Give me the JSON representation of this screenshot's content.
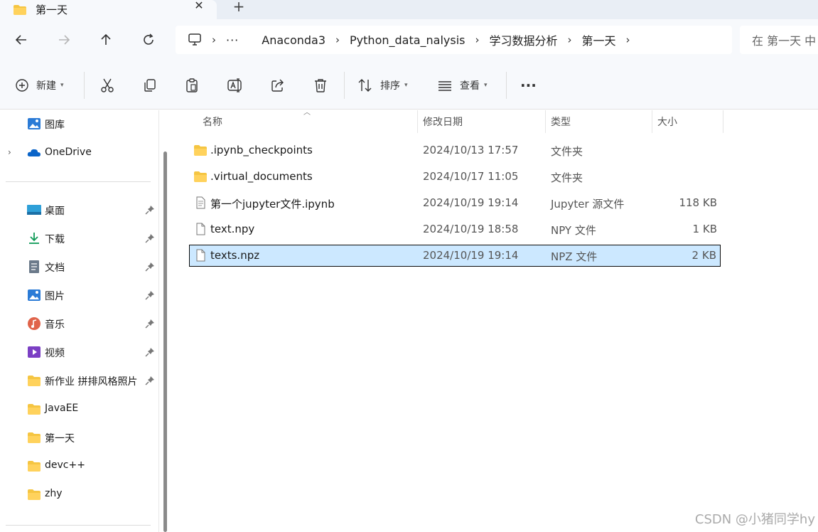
{
  "tab": {
    "title": "第一天",
    "close": "✕",
    "new_tab": "+"
  },
  "nav": {
    "back": "back",
    "forward": "forward",
    "up": "up",
    "refresh": "refresh"
  },
  "breadcrumb": {
    "ellipsis": "···",
    "items": [
      "Anaconda3",
      "Python_data_nalysis",
      "学习数据分析",
      "第一天"
    ]
  },
  "search": {
    "placeholder": "在 第一天 中"
  },
  "toolbar": {
    "new_label": "新建",
    "sort_label": "排序",
    "view_label": "查看",
    "more": "···"
  },
  "sidebar": {
    "top": [
      {
        "label": "图库",
        "icon": "gallery-icon"
      },
      {
        "label": "OneDrive",
        "icon": "cloud-icon"
      }
    ],
    "quick": [
      {
        "label": "桌面",
        "icon": "desktop-icon",
        "pinned": true
      },
      {
        "label": "下载",
        "icon": "download-icon",
        "pinned": true
      },
      {
        "label": "文档",
        "icon": "document-icon",
        "pinned": true
      },
      {
        "label": "图片",
        "icon": "pictures-icon",
        "pinned": true
      },
      {
        "label": "音乐",
        "icon": "music-icon",
        "pinned": true
      },
      {
        "label": "视频",
        "icon": "video-icon",
        "pinned": true
      },
      {
        "label": "新作业 拼排风格照片",
        "icon": "folder-icon",
        "pinned": true
      },
      {
        "label": "JavaEE",
        "icon": "folder-icon",
        "pinned": false
      },
      {
        "label": "第一天",
        "icon": "folder-icon",
        "pinned": false
      },
      {
        "label": "devc++",
        "icon": "folder-icon",
        "pinned": false
      },
      {
        "label": "zhy",
        "icon": "folder-icon",
        "pinned": false
      }
    ]
  },
  "columns": {
    "name": "名称",
    "date": "修改日期",
    "type": "类型",
    "size": "大小"
  },
  "files": [
    {
      "name": ".ipynb_checkpoints",
      "date": "2024/10/13 17:57",
      "type": "文件夹",
      "size": "",
      "icon": "folder-icon"
    },
    {
      "name": ".virtual_documents",
      "date": "2024/10/17 11:05",
      "type": "文件夹",
      "size": "",
      "icon": "folder-icon"
    },
    {
      "name": "第一个jupyter文件.ipynb",
      "date": "2024/10/19 19:14",
      "type": "Jupyter 源文件",
      "size": "118 KB",
      "icon": "notebook-file-icon"
    },
    {
      "name": "text.npy",
      "date": "2024/10/19 18:58",
      "type": "NPY 文件",
      "size": "1 KB",
      "icon": "file-icon"
    },
    {
      "name": "texts.npz",
      "date": "2024/10/19 19:14",
      "type": "NPZ 文件",
      "size": "2 KB",
      "icon": "file-icon"
    }
  ],
  "watermark": "CSDN @小猪同学hy",
  "colors": {
    "selection": "#cce8ff",
    "folder": "#f5c542",
    "chrome": "#f7f9fc"
  }
}
